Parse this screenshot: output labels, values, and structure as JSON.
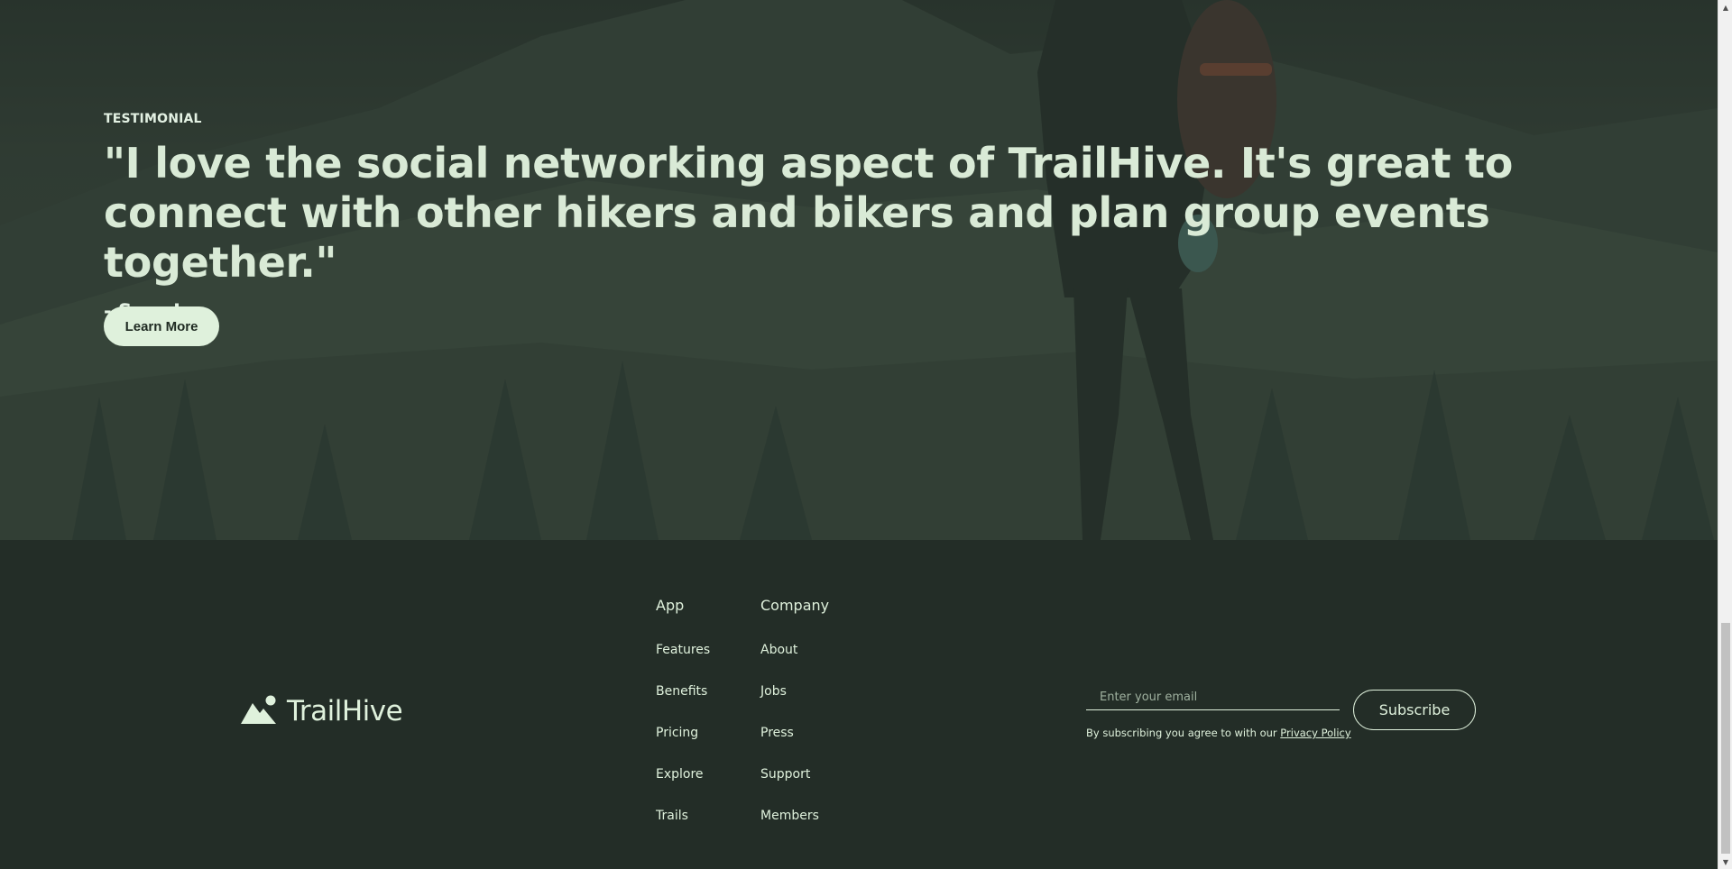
{
  "testimonial": {
    "eyebrow": "TESTIMONIAL",
    "quote": "\"I love the social networking aspect of TrailHive. It's great to connect with other hikers and bikers and plan group events together.\"",
    "author": "- Sara L.",
    "button_label": "Learn More"
  },
  "footer": {
    "brand": "TrailHive",
    "columns": [
      {
        "title": "App",
        "links": [
          "Features",
          "Benefits",
          "Pricing",
          "Explore",
          "Trails"
        ]
      },
      {
        "title": "Company",
        "links": [
          "About",
          "Jobs",
          "Press",
          "Support",
          "Members"
        ]
      }
    ],
    "subscribe": {
      "placeholder": "Enter your email",
      "button_label": "Subscribe",
      "note": "By subscribing you agree to with our",
      "policy_link": "Privacy Policy"
    }
  },
  "colors": {
    "background": "#232d27",
    "accent": "#dff1dc",
    "button_text": "#1f2a22"
  },
  "icons": {
    "logo": "mountain-sun-icon",
    "scroll_up": "triangle-up-icon",
    "scroll_down": "triangle-down-icon"
  }
}
